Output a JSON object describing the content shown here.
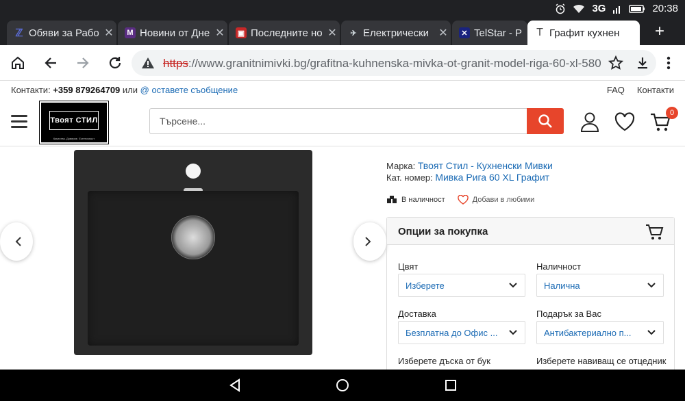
{
  "status": {
    "network": "3G",
    "time": "20:38"
  },
  "tabs": [
    {
      "title": "Обяви за Рабо",
      "fav_color": "#5b6cd6",
      "fav_char": "ℤ"
    },
    {
      "title": "Новини от Дне",
      "fav_color": "#5a2d82",
      "fav_char": "M"
    },
    {
      "title": "Последните но",
      "fav_color": "#c62828",
      "fav_char": "▣"
    },
    {
      "title": "Електрически",
      "fav_color": "#455a64",
      "fav_char": "✈"
    },
    {
      "title": "TelStar - P",
      "fav_color": "#1a237e",
      "fav_char": "✕"
    },
    {
      "title": "Графит кухнен",
      "fav_color": "#ffffff",
      "fav_char": "T"
    }
  ],
  "omnibox": {
    "scheme": "https",
    "rest": "://www.granitnimivki.bg/grafitna-kuhnenska-mivka-ot-granit-model-riga-60-xl-580-"
  },
  "topinfo": {
    "contacts_label": "Контакти:",
    "phone": "+359 879264709",
    "or": "или",
    "message": "@ оставете съобщение",
    "faq": "FAQ",
    "contacts": "Контакти"
  },
  "header": {
    "logo_title": "Твоят СТИЛ",
    "logo_sub": "Качество. Доверие. Естетичност",
    "search_placeholder": "Търсене...",
    "cart_count": "0"
  },
  "product": {
    "brand_label": "Марка:",
    "brand": "Твоят Стил - Кухненски Мивки",
    "sku_label": "Кат. номер:",
    "sku": "Мивка Рига 60 XL Графит",
    "stock": "В наличност",
    "wishlist": "Добави в любими"
  },
  "options": {
    "title": "Опции за покупка",
    "color_label": "Цвят",
    "color_value": "Изберете",
    "availability_label": "Наличност",
    "availability_value": "Налична",
    "delivery_label": "Доставка",
    "delivery_value": "Безплатна до Офис ...",
    "gift_label": "Подарък за Вас",
    "gift_value": "Антибактериално п...",
    "board_label": "Изберете дъска от бук",
    "drain_label": "Изберете навиващ се отцедник"
  }
}
